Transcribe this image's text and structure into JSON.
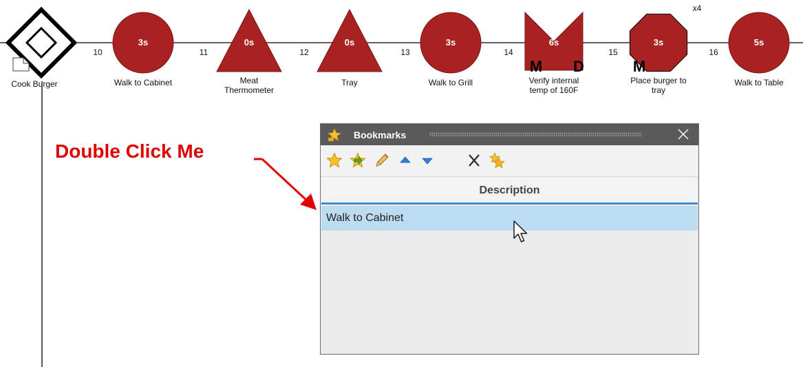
{
  "process": {
    "start_label": "Cook Burger",
    "steps": [
      {
        "num": "10",
        "time": "3s",
        "shape": "circle",
        "label1": "Walk to Cabinet",
        "label2": "",
        "m": "",
        "d": ""
      },
      {
        "num": "11",
        "time": "0s",
        "shape": "triangle",
        "label1": "Meat",
        "label2": "Thermometer",
        "m": "",
        "d": ""
      },
      {
        "num": "12",
        "time": "0s",
        "shape": "triangle",
        "label1": "Tray",
        "label2": "",
        "m": "",
        "d": ""
      },
      {
        "num": "13",
        "time": "3s",
        "shape": "circle",
        "label1": "Walk to Grill",
        "label2": "",
        "m": "",
        "d": ""
      },
      {
        "num": "14",
        "time": "6s",
        "shape": "bowtie",
        "label1": "Verify internal",
        "label2": "temp of 160F",
        "m": "M",
        "d": "D"
      },
      {
        "num": "15",
        "time": "3s",
        "shape": "octagon",
        "label1": "Place burger to",
        "label2": "tray",
        "m": "M",
        "d": ""
      },
      {
        "num": "16",
        "time": "5s",
        "shape": "circle",
        "label1": "Walk to Table",
        "label2": "",
        "m": "",
        "d": ""
      }
    ],
    "repeat_badge": "x4"
  },
  "annotation": {
    "text": "Double Click Me"
  },
  "bookmarks": {
    "title": "Bookmarks",
    "toolbar": [
      {
        "icon": "star-icon",
        "tooltip": "add-bookmark"
      },
      {
        "icon": "star-go-icon",
        "tooltip": "go-to-bookmark"
      },
      {
        "icon": "pencil-icon",
        "tooltip": "edit-bookmark"
      },
      {
        "icon": "arrow-up-icon",
        "tooltip": "move-up"
      },
      {
        "icon": "arrow-down-icon",
        "tooltip": "move-down"
      },
      {
        "icon": "delete-icon",
        "tooltip": "delete-bookmark"
      },
      {
        "icon": "stars-icon",
        "tooltip": "bookmark-all"
      }
    ],
    "column_header": "Description",
    "rows": [
      "Walk to Cabinet"
    ]
  },
  "colors": {
    "shape_fill": "#a82222",
    "shape_stroke": "#7a1515",
    "annotation": "#e00000",
    "selection": "#bcdcf1",
    "header_underline": "#3f8fcf",
    "titlebar": "#5a5a5a"
  }
}
